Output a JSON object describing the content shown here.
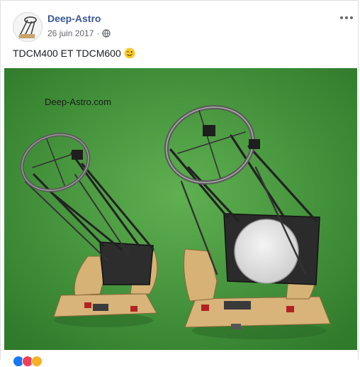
{
  "post": {
    "author": "Deep-Astro",
    "date": "26 juin 2017",
    "separator": "·",
    "privacy_icon": "globe-icon",
    "text": "TDCM400 ET TDCM600",
    "emoji": "winking-face-emoji"
  },
  "photo": {
    "watermark": "Deep-Astro.com"
  },
  "colors": {
    "author_link": "#385898",
    "background_green": "#3a8d35",
    "reaction_like": "#1877f2",
    "reaction_love": "#f33e58",
    "reaction_haha": "#f7b125"
  }
}
